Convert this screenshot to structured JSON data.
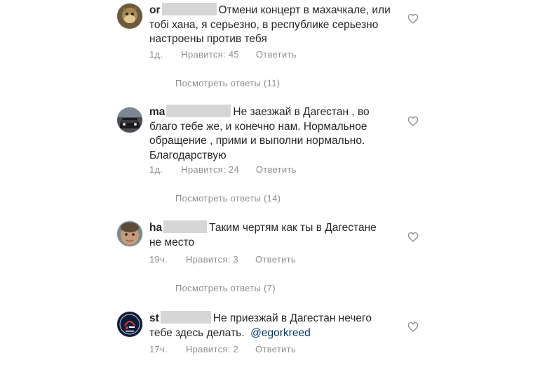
{
  "comments": [
    {
      "username": "or",
      "text": "Отмени концерт в махачкале, или тобі хана, я серьезно, в республике серьезно настроены против тебя",
      "time": "1д.",
      "likes": "Нравится: 45",
      "reply": "Ответить",
      "view_replies": "Посмотреть ответы (11)"
    },
    {
      "username": "ma",
      "text": "Не заезжай в Дагестан , во благо тебе же, и конечно нам. Нормальное обращение , прими и выполни нормально. Благодарствую",
      "time": "1д.",
      "likes": "Нравится: 24",
      "reply": "Ответить",
      "view_replies": "Посмотреть ответы (14)"
    },
    {
      "username": "ha",
      "text": "Таким чертям как ты в Дагестане не место",
      "time": "19ч.",
      "likes": "Нравится: 3",
      "reply": "Ответить",
      "view_replies": "Посмотреть ответы (7)"
    },
    {
      "username": "st",
      "text": "Не приезжай в Дагестан нечего тебе здесь делать.",
      "mention": "@egorkreed",
      "time": "17ч.",
      "likes": "Нравится: 2",
      "reply": "Ответить"
    }
  ],
  "icons": {
    "like": "heart-outline-icon"
  },
  "colors": {
    "text": "#262626",
    "meta": "#8e8e8e",
    "mention": "#00376b",
    "redaction": "#d6d6d6"
  }
}
